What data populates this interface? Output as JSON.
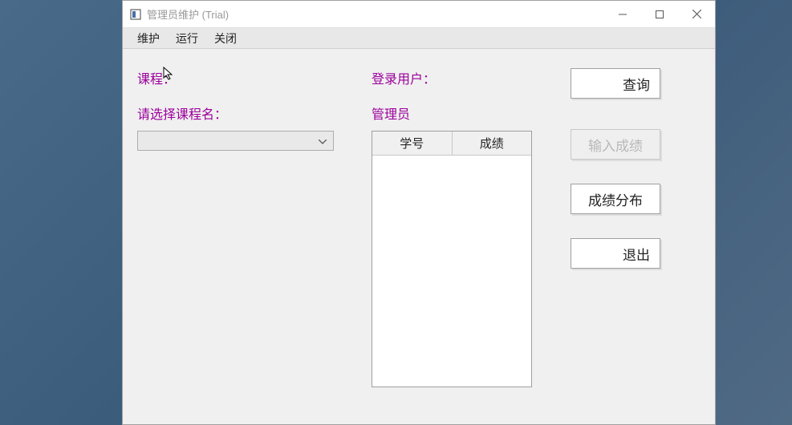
{
  "window": {
    "title": "管理员维护 (Trial)"
  },
  "menu": {
    "maintain": "维护",
    "run": "运行",
    "close": "关闭"
  },
  "labels": {
    "course": "课程：",
    "select_course": "请选择课程名：",
    "login_user": "登录用户：",
    "admin": "管理员"
  },
  "grid": {
    "col_student_id": "学号",
    "col_score": "成绩"
  },
  "buttons": {
    "query": "查询",
    "input_score": "输入成绩",
    "score_distribution": "成绩分布",
    "exit": "退出"
  }
}
